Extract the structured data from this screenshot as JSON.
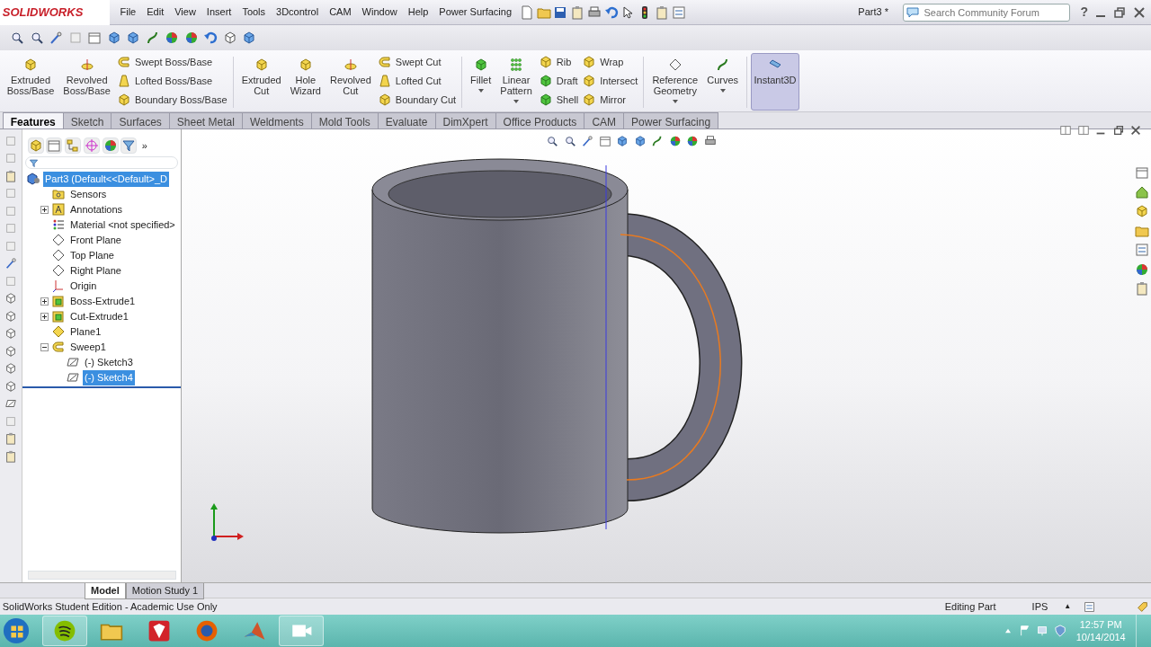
{
  "app": {
    "logo": "SOLIDWORKS",
    "document_title": "Part3 *"
  },
  "menu": [
    "File",
    "Edit",
    "View",
    "Insert",
    "Tools",
    "3Dcontrol",
    "CAM",
    "Window",
    "Help",
    "Power Surfacing"
  ],
  "search": {
    "placeholder": "Search Community Forum"
  },
  "help_label": "?",
  "ribbon": [
    {
      "kind": "large",
      "lines": [
        "Extruded",
        "Boss/Base"
      ],
      "has_menu": false,
      "selected": false
    },
    {
      "kind": "large",
      "lines": [
        "Revolved",
        "Boss/Base"
      ],
      "has_menu": false,
      "selected": false
    },
    {
      "kind": "stack",
      "items": [
        {
          "label": "Swept Boss/Base"
        },
        {
          "label": "Lofted Boss/Base"
        },
        {
          "label": "Boundary Boss/Base"
        }
      ]
    },
    {
      "kind": "separator"
    },
    {
      "kind": "large",
      "lines": [
        "Extruded",
        "Cut"
      ],
      "has_menu": false,
      "selected": false
    },
    {
      "kind": "large",
      "lines": [
        "Hole",
        "Wizard"
      ],
      "has_menu": false,
      "selected": false
    },
    {
      "kind": "large",
      "lines": [
        "Revolved",
        "Cut"
      ],
      "has_menu": false,
      "selected": false
    },
    {
      "kind": "stack",
      "items": [
        {
          "label": "Swept Cut"
        },
        {
          "label": "Lofted Cut"
        },
        {
          "label": "Boundary Cut"
        }
      ]
    },
    {
      "kind": "separator"
    },
    {
      "kind": "large",
      "lines": [
        "Fillet"
      ],
      "has_menu": true,
      "selected": false
    },
    {
      "kind": "large",
      "lines": [
        "Linear",
        "Pattern"
      ],
      "has_menu": true,
      "selected": false
    },
    {
      "kind": "stack",
      "items": [
        {
          "label": "Rib"
        },
        {
          "label": "Draft"
        },
        {
          "label": "Shell"
        }
      ]
    },
    {
      "kind": "stack",
      "items": [
        {
          "label": "Wrap"
        },
        {
          "label": "Intersect"
        },
        {
          "label": "Mirror"
        }
      ]
    },
    {
      "kind": "separator"
    },
    {
      "kind": "large",
      "lines": [
        "Reference",
        "Geometry"
      ],
      "has_menu": true,
      "selected": false
    },
    {
      "kind": "large",
      "lines": [
        "Curves"
      ],
      "has_menu": true,
      "selected": false
    },
    {
      "kind": "separator"
    },
    {
      "kind": "large",
      "lines": [
        "Instant3D"
      ],
      "has_menu": false,
      "selected": true
    }
  ],
  "tabs": [
    {
      "label": "Features",
      "selected": true
    },
    {
      "label": "Sketch",
      "selected": false
    },
    {
      "label": "Surfaces",
      "selected": false
    },
    {
      "label": "Sheet Metal",
      "selected": false
    },
    {
      "label": "Weldments",
      "selected": false
    },
    {
      "label": "Mold Tools",
      "selected": false
    },
    {
      "label": "Evaluate",
      "selected": false
    },
    {
      "label": "DimXpert",
      "selected": false
    },
    {
      "label": "Office Products",
      "selected": false
    },
    {
      "label": "CAM",
      "selected": false
    },
    {
      "label": "Power Surfacing",
      "selected": false
    }
  ],
  "tree_more": "»",
  "tree": {
    "label": "Part3  (Default<<Default>_D",
    "kind": "part",
    "selected": true,
    "children": [
      {
        "label": "Sensors",
        "kind": "folder",
        "selected": false
      },
      {
        "label": "Annotations",
        "kind": "annotation",
        "selected": false,
        "expanded": false
      },
      {
        "label": "Material <not specified>",
        "kind": "material",
        "selected": false
      },
      {
        "label": "Front Plane",
        "kind": "plane",
        "selected": false
      },
      {
        "label": "Top Plane",
        "kind": "plane",
        "selected": false
      },
      {
        "label": "Right Plane",
        "kind": "plane",
        "selected": false
      },
      {
        "label": "Origin",
        "kind": "origin",
        "selected": false
      },
      {
        "label": "Boss-Extrude1",
        "kind": "feature",
        "selected": false,
        "expanded": false
      },
      {
        "label": "Cut-Extrude1",
        "kind": "feature",
        "selected": false,
        "expanded": false
      },
      {
        "label": "Plane1",
        "kind": "yplane",
        "selected": false
      },
      {
        "label": "Sweep1",
        "kind": "sweep",
        "selected": false,
        "expanded": true,
        "children": [
          {
            "label": "(-) Sketch3",
            "kind": "sketch",
            "selected": false
          },
          {
            "label": "(-) Sketch4",
            "kind": "sketch",
            "selected": true
          }
        ]
      }
    ]
  },
  "model_tabs": [
    {
      "label": "Model",
      "selected": true
    },
    {
      "label": "Motion Study 1",
      "selected": false
    }
  ],
  "status_bar": {
    "message": "SolidWorks Student Edition - Academic Use Only",
    "mode": "Editing Part",
    "units": "IPS",
    "units_caret": "▲"
  },
  "taskbar": {
    "time": "12:57 PM",
    "date": "10/14/2014"
  }
}
